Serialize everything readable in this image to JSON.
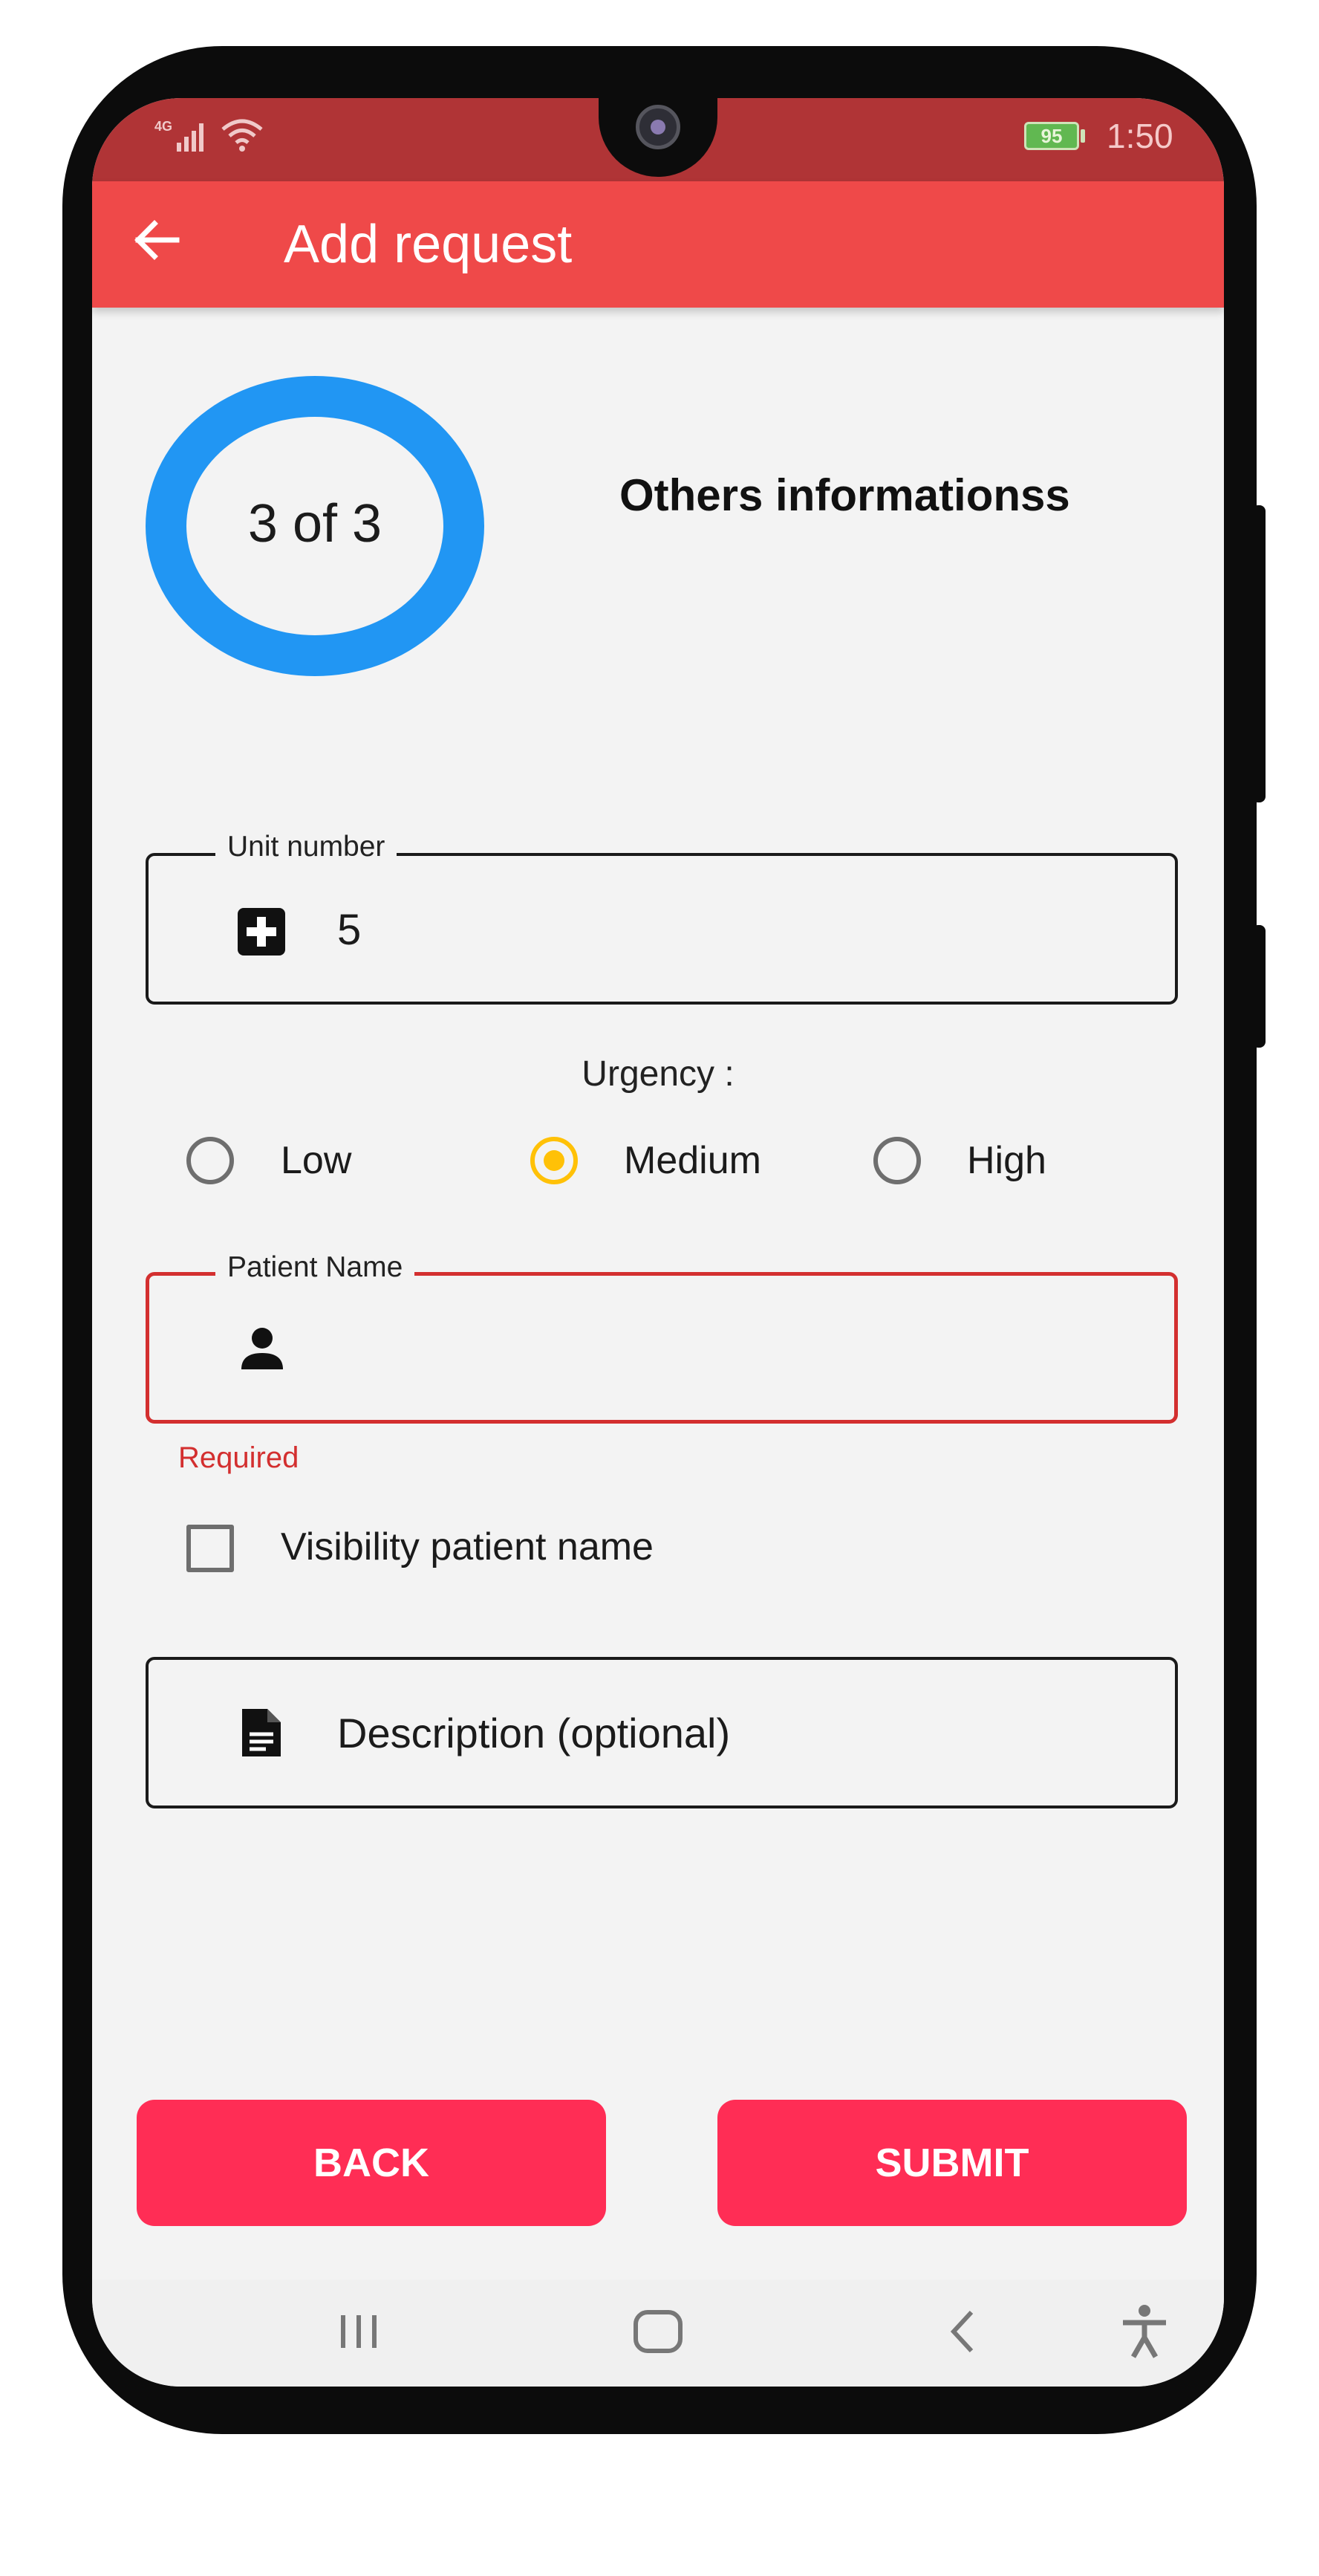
{
  "status_bar": {
    "network_label": "4G",
    "battery_level": "95",
    "time": "1:50"
  },
  "app_bar": {
    "title": "Add request"
  },
  "progress": {
    "step_text": "3 of 3",
    "current_step": 3,
    "total_steps": 3,
    "ring_color": "#2196f3"
  },
  "section": {
    "title": "Others informationss"
  },
  "unit_number": {
    "label": "Unit number",
    "value": "5"
  },
  "urgency": {
    "label": "Urgency :",
    "options": [
      {
        "label": "Low",
        "selected": false
      },
      {
        "label": "Medium",
        "selected": true
      },
      {
        "label": "High",
        "selected": false
      }
    ]
  },
  "patient_name": {
    "label": "Patient Name",
    "value": "",
    "error": "Required"
  },
  "visibility_checkbox": {
    "label": "Visibility patient name",
    "checked": false
  },
  "description": {
    "placeholder": "Description (optional)",
    "value": ""
  },
  "buttons": {
    "back": "BACK",
    "submit": "SUBMIT"
  },
  "colors": {
    "status_bar": "#b03436",
    "app_bar": "#ef4949",
    "button": "#ff2d55",
    "radio_selected": "#ffc107",
    "error": "#d32f2f"
  },
  "icons": {
    "back": "arrow-back-icon",
    "unit": "medical-plus-icon",
    "patient": "person-icon",
    "description": "document-icon",
    "nav": [
      "recent-apps-icon",
      "home-icon",
      "back-icon",
      "accessibility-icon"
    ]
  }
}
